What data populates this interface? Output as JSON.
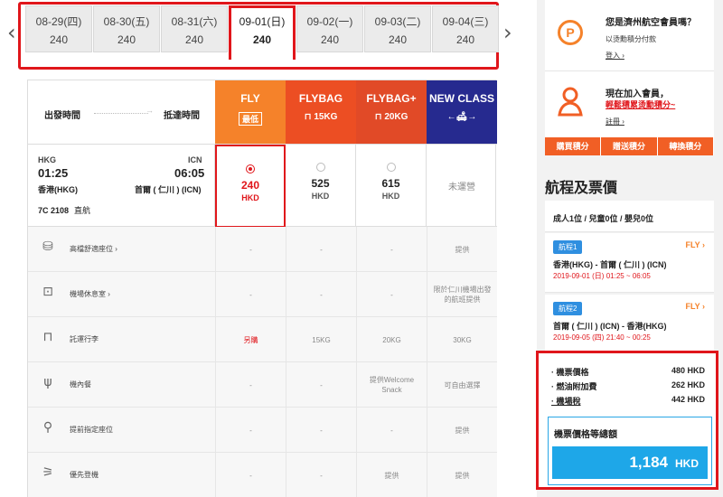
{
  "nav": {
    "prev_icon": "chevron-left-icon",
    "next_icon": "chevron-right-icon",
    "prev_glyph": "‹",
    "next_glyph": "›"
  },
  "dates": [
    {
      "date": "08-29(四)",
      "price": "240"
    },
    {
      "date": "08-30(五)",
      "price": "240"
    },
    {
      "date": "08-31(六)",
      "price": "240"
    },
    {
      "date": "09-01(日)",
      "price": "240",
      "active": true
    },
    {
      "date": "09-02(一)",
      "price": "240"
    },
    {
      "date": "09-03(二)",
      "price": "240"
    },
    {
      "date": "09-04(三)",
      "price": "240"
    }
  ],
  "table": {
    "dep_label": "出發時間",
    "arr_label": "抵達時間",
    "fares": [
      {
        "name": "FLY",
        "sub": "最低",
        "color": "#f5822a"
      },
      {
        "name": "FLYBAG",
        "sub": "15KG",
        "color": "#ec4e23"
      },
      {
        "name": "FLYBAG+",
        "sub": "20KG",
        "color": "#e14a27"
      },
      {
        "name": "NEW CLASS",
        "sub": "←🛋→",
        "color": "#262a8f"
      }
    ],
    "flight": {
      "dep_code": "HKG",
      "arr_code": "ICN",
      "dep_time": "01:25",
      "arr_time": "06:05",
      "dep_name": "香港(HKG)",
      "arr_name": "首爾 ( 仁川 ) (ICN)",
      "number": "7C 2108",
      "type": "直航",
      "prices": [
        {
          "price": "240",
          "cur": "HKD",
          "selected": true
        },
        {
          "price": "525",
          "cur": "HKD"
        },
        {
          "price": "615",
          "cur": "HKD"
        },
        {
          "na": "未運營"
        }
      ]
    },
    "rows": [
      {
        "icon": "seat-icon",
        "glyph": "⛁",
        "label": "高檔舒適座位 ›",
        "values": [
          "-",
          "-",
          "-",
          "提供"
        ]
      },
      {
        "icon": "lounge-icon",
        "glyph": "⊡",
        "label": "機場休息室 ›",
        "values": [
          "-",
          "-",
          "-",
          "限於仁川機場出發的航班提供"
        ]
      },
      {
        "icon": "baggage-icon",
        "glyph": "⊓",
        "label": "託運行李",
        "values": [
          "另購",
          "15KG",
          "20KG",
          "30KG"
        ],
        "red": [
          true,
          false,
          false,
          false
        ]
      },
      {
        "icon": "meal-icon",
        "glyph": "ψ",
        "label": "機內餐",
        "values": [
          "-",
          "-",
          "提供Welcome Snack",
          "可自由選擇"
        ]
      },
      {
        "icon": "seat-select-icon",
        "glyph": "⚲",
        "label": "提前指定座位",
        "values": [
          "-",
          "-",
          "-",
          "提供"
        ]
      },
      {
        "icon": "priority-boarding-icon",
        "glyph": "⚞",
        "label": "優先登機",
        "values": [
          "-",
          "-",
          "提供",
          "提供"
        ]
      }
    ]
  },
  "sidebar": {
    "member1": {
      "title": "您是濟州航空會員嗎？",
      "desc": "以烫勳積分付款",
      "link": "登入 ›",
      "icon": "points-icon",
      "glyph": "P"
    },
    "member2": {
      "title": "現在加入會員，",
      "desc": "輕鬆積累烫勳積分~",
      "link": "註冊 ›",
      "icon": "person-icon"
    },
    "points_buttons": [
      "購買積分",
      "贈送積分",
      "轉換積分"
    ],
    "summary_title": "航程及票價",
    "pax": "成人1位 / 兒童0位 / 嬰兒0位",
    "legs": [
      {
        "badge": "航程1",
        "fare": "FLY ›",
        "route": "香港(HKG) - 首爾 ( 仁川 ) (ICN)",
        "datetime": "2019-09-01 (日) 01:25 ~ 06:05"
      },
      {
        "badge": "航程2",
        "fare": "FLY ›",
        "route": "首爾 ( 仁川 ) (ICN) - 香港(HKG)",
        "datetime": "2019-09-05 (四) 21:40 ~ 00:25"
      }
    ],
    "breakdown": [
      {
        "label": "· 機票價格",
        "value": "480 HKD"
      },
      {
        "label": "· 燃油附加費",
        "value": "262 HKD"
      },
      {
        "label": "· 機場稅",
        "value": "442 HKD",
        "underline": true
      }
    ],
    "total_label": "機票價格等總額",
    "total_amount": "1,184",
    "total_currency": "HKD"
  },
  "colors": {
    "highlight": "#e0161b",
    "fly": "#f5822a",
    "flybag": "#ec4e23",
    "flybagplus": "#e14a27",
    "newclass": "#262a8f",
    "total": "#1ea7e8"
  }
}
